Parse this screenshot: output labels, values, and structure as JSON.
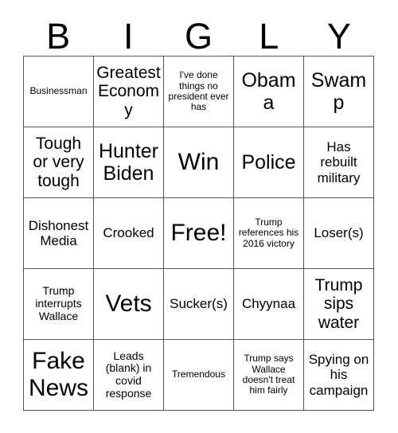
{
  "card": {
    "title_letters": [
      "B",
      "I",
      "G",
      "L",
      "Y"
    ],
    "columns": 5,
    "rows": 5,
    "colors": {
      "background": "#ffffff",
      "text": "#000000",
      "grid_line": "#555555"
    },
    "cells": [
      {
        "text": "Businessman",
        "size": "xs"
      },
      {
        "text": "Greatest Economy",
        "size": "l"
      },
      {
        "text": "I've done things no president ever has",
        "size": "xs"
      },
      {
        "text": "Obama",
        "size": "xl"
      },
      {
        "text": "Swamp",
        "size": "xl"
      },
      {
        "text": "Tough or very tough",
        "size": "l"
      },
      {
        "text": "Hunter Biden",
        "size": "xl"
      },
      {
        "text": "Win",
        "size": "xxl"
      },
      {
        "text": "Police",
        "size": "xl"
      },
      {
        "text": "Has rebuilt military",
        "size": "m"
      },
      {
        "text": "Dishonest Media",
        "size": "m"
      },
      {
        "text": "Crooked",
        "size": "m"
      },
      {
        "text": "Free!",
        "size": "free"
      },
      {
        "text": "Trump references his 2016 victory",
        "size": "xs"
      },
      {
        "text": "Loser(s)",
        "size": "m"
      },
      {
        "text": "Trump interrupts Wallace",
        "size": "s"
      },
      {
        "text": "Vets",
        "size": "xxl"
      },
      {
        "text": "Sucker(s)",
        "size": "m"
      },
      {
        "text": "Chyynaa",
        "size": "m"
      },
      {
        "text": "Trump sips water",
        "size": "l"
      },
      {
        "text": "Fake News",
        "size": "xxl"
      },
      {
        "text": "Leads (blank) in covid response",
        "size": "s"
      },
      {
        "text": "Tremendous",
        "size": "xs"
      },
      {
        "text": "Trump says Wallace doesn't treat him fairly",
        "size": "xs"
      },
      {
        "text": "Spying on his campaign",
        "size": "m"
      }
    ]
  }
}
